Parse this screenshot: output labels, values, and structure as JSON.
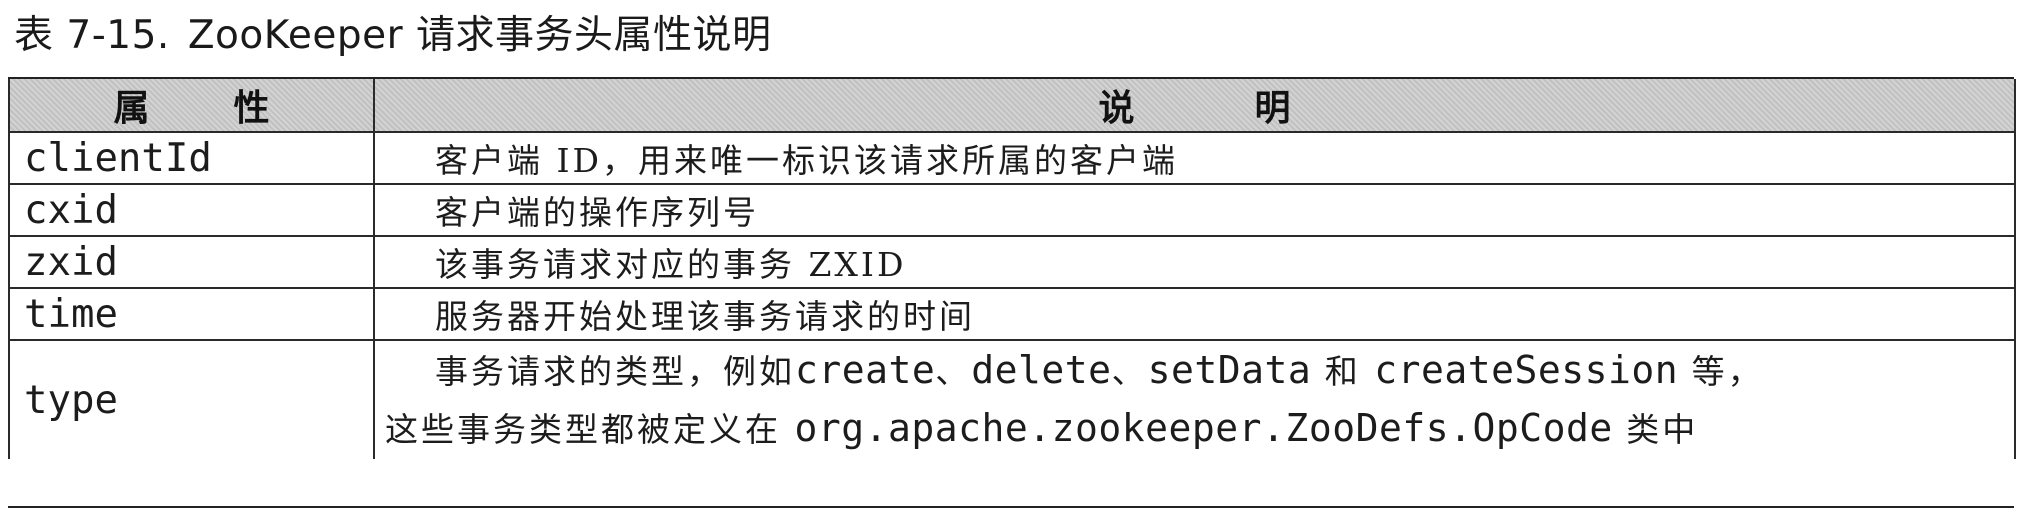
{
  "caption": {
    "label": "表 7-15.",
    "title": "ZooKeeper 请求事务头属性说明"
  },
  "table": {
    "headers": {
      "attribute": "属性",
      "description": "说明"
    },
    "rows": [
      {
        "attribute": "clientId",
        "description": "客户端 ID，用来唯一标识该请求所属的客户端"
      },
      {
        "attribute": "cxid",
        "description": "客户端的操作序列号"
      },
      {
        "attribute": "zxid",
        "description": "该事务请求对应的事务 ZXID"
      },
      {
        "attribute": "time",
        "description": "服务器开始处理该事务请求的时间"
      }
    ],
    "type_row": {
      "attribute": "type",
      "line1": {
        "t1": "事务请求的类型，例如",
        "c1": "create",
        "s1": "、",
        "c2": "delete",
        "s2": "、",
        "c3": "setData",
        "t2": "和",
        "c4": "createSession",
        "t3": "等，"
      },
      "line2": {
        "t1": "这些事务类型都被定义在",
        "c1": "org.apache.zookeeper.ZooDefs.OpCode",
        "t2": "类中"
      }
    }
  }
}
